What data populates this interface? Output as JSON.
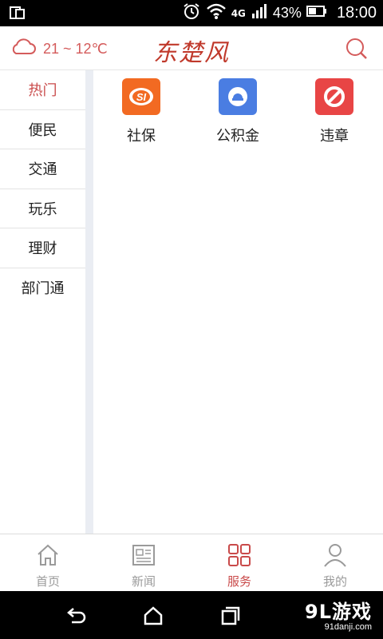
{
  "status_bar": {
    "battery_percent": "43%",
    "network": "4G",
    "time": "18:00",
    "icons": [
      "screen-mirror-icon",
      "alarm-icon",
      "wifi-icon",
      "signal-icon",
      "battery-icon"
    ]
  },
  "header": {
    "weather_icon": "cloud-icon",
    "temperature": "21 ~ 12℃",
    "brand": "东楚风",
    "search_icon": "search-icon",
    "accent": "#c94a4a"
  },
  "left_menu": {
    "items": [
      {
        "label": "热门",
        "active": true
      },
      {
        "label": "便民",
        "active": false
      },
      {
        "label": "交通",
        "active": false
      },
      {
        "label": "玩乐",
        "active": false
      },
      {
        "label": "理财",
        "active": false
      },
      {
        "label": "部门通",
        "active": false
      }
    ]
  },
  "services": [
    {
      "label": "社保",
      "icon": "social-security-icon",
      "color": "#f26a22"
    },
    {
      "label": "公积金",
      "icon": "housing-fund-icon",
      "color": "#4a7de2"
    },
    {
      "label": "违章",
      "icon": "no-entry-icon",
      "color": "#e84545"
    }
  ],
  "tab_bar": {
    "tabs": [
      {
        "label": "首页",
        "icon": "home-icon",
        "active": false
      },
      {
        "label": "新闻",
        "icon": "news-icon",
        "active": false
      },
      {
        "label": "服务",
        "icon": "grid-icon",
        "active": true
      },
      {
        "label": "我的",
        "icon": "user-icon",
        "active": false
      }
    ]
  },
  "nav_bar": {
    "icons": [
      "back-icon",
      "home-nav-icon",
      "recents-icon"
    ],
    "watermark_big": "9L游戏",
    "watermark_small": "91danji.com"
  }
}
